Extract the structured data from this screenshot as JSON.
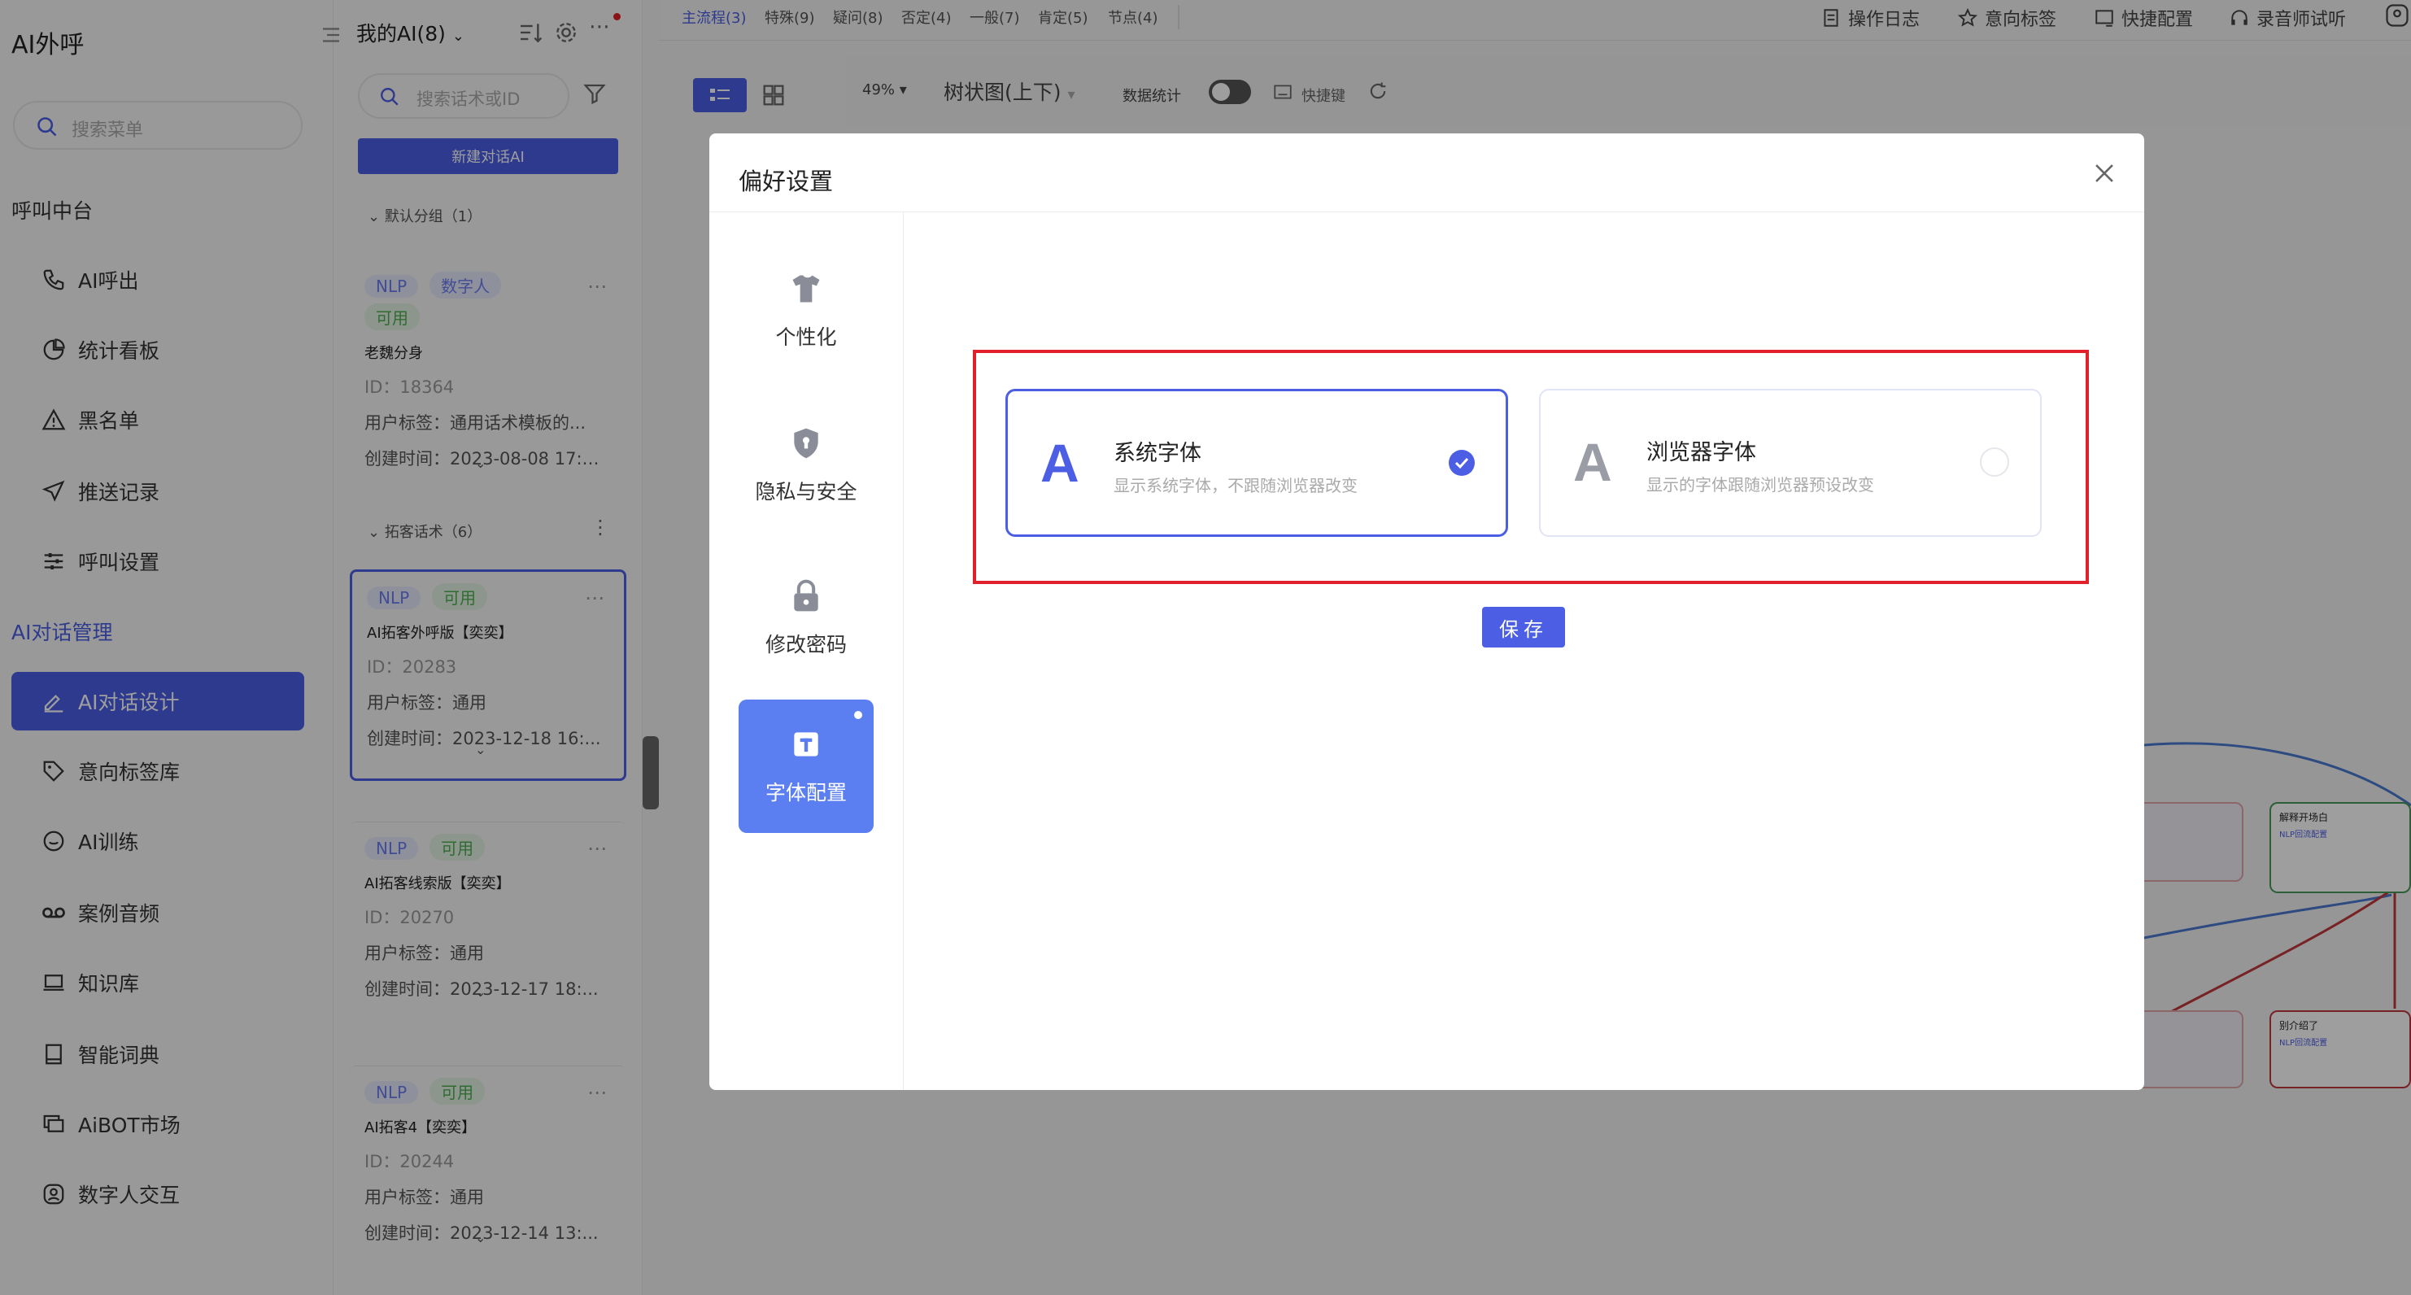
{
  "app": {
    "title": "AI外呼"
  },
  "sidebar": {
    "search_placeholder": "搜索菜单",
    "section1": "呼叫中台",
    "items1": [
      {
        "label": "AI呼出",
        "icon": "phone-icon"
      },
      {
        "label": "统计看板",
        "icon": "pie-chart-icon"
      },
      {
        "label": "黑名单",
        "icon": "warning-icon"
      },
      {
        "label": "推送记录",
        "icon": "send-icon"
      },
      {
        "label": "呼叫设置",
        "icon": "sliders-icon"
      }
    ],
    "section2": "AI对话管理",
    "items2": [
      {
        "label": "AI对话设计",
        "icon": "edit-icon",
        "active": true
      },
      {
        "label": "意向标签库",
        "icon": "tag-icon"
      },
      {
        "label": "AI训练",
        "icon": "chat-icon"
      },
      {
        "label": "案例音频",
        "icon": "voicemail-icon"
      },
      {
        "label": "知识库",
        "icon": "laptop-icon"
      },
      {
        "label": "智能词典",
        "icon": "book-icon"
      },
      {
        "label": "AiBOT市场",
        "icon": "market-icon"
      },
      {
        "label": "数字人交互",
        "icon": "avatar-icon"
      }
    ]
  },
  "panel": {
    "heading": "我的AI(8)",
    "search_placeholder": "搜索话术或ID",
    "new_button": "新建对话AI",
    "group1": "默认分组（1）",
    "group2": "拓客话术（6）",
    "cards": [
      {
        "tags": [
          "NLP",
          "数字人",
          "可用"
        ],
        "name": "老魏分身",
        "id": "ID：18364",
        "user_tag": "用户标签：通用话术模板的...",
        "created": "创建时间：2023-08-08 17:4..."
      },
      {
        "tags": [
          "NLP",
          "可用"
        ],
        "name": "AI拓客外呼版【奕奕】",
        "id": "ID：20283",
        "user_tag": "用户标签：通用",
        "created": "创建时间：2023-12-18 16:..."
      },
      {
        "tags": [
          "NLP",
          "可用"
        ],
        "name": "AI拓客线索版【奕奕】",
        "id": "ID：20270",
        "user_tag": "用户标签：通用",
        "created": "创建时间：2023-12-17 18:..."
      },
      {
        "tags": [
          "NLP",
          "可用"
        ],
        "name": "AI拓客4【奕奕】",
        "id": "ID：20244",
        "user_tag": "用户标签：通用",
        "created": "创建时间：2023-12-14 13:..."
      }
    ]
  },
  "topbar": {
    "tabs": [
      "主流程(3)",
      "特殊(9)",
      "疑问(8)",
      "否定(4)",
      "一般(7)",
      "肯定(5)",
      "节点(4)"
    ],
    "actions": [
      "操作日志",
      "意向标签",
      "快捷配置",
      "录音师试听"
    ]
  },
  "toolbar": {
    "zoom": "49%",
    "view": "树状图(上下)",
    "stats_label": "数据统计",
    "shortcut_label": "快捷键"
  },
  "canvas": {
    "node1_title": "解释开场白",
    "node1_sub": "NLP回流配置",
    "node2_title": "别介绍了",
    "node2_sub": "NLP回流配置"
  },
  "modal": {
    "title": "偏好设置",
    "side": [
      {
        "label": "个性化",
        "icon": "shirt-icon"
      },
      {
        "label": "隐私与安全",
        "icon": "shield-icon"
      },
      {
        "label": "修改密码",
        "icon": "lock-icon"
      },
      {
        "label": "字体配置",
        "icon": "font-icon",
        "active": true
      }
    ],
    "system_font": {
      "glyph": "A",
      "title": "系统字体",
      "desc": "显示系统字体，不跟随浏览器改变",
      "selected": true
    },
    "browser_font": {
      "glyph": "A",
      "title": "浏览器字体",
      "desc": "显示的字体跟随浏览器预设改变",
      "selected": false
    },
    "save": "保存"
  },
  "colors": {
    "accent": "#4b5ee4",
    "highlight": "#e0202a"
  }
}
